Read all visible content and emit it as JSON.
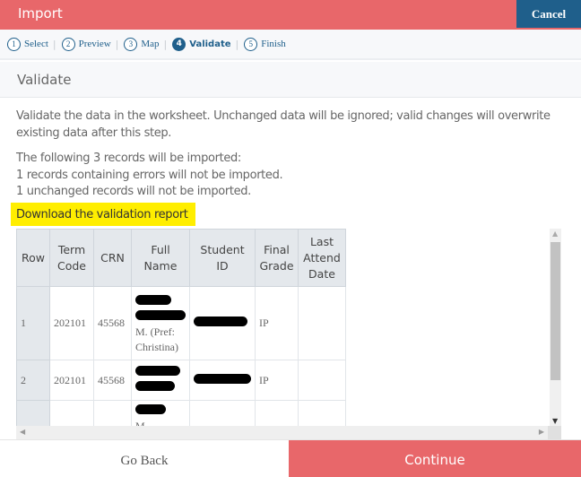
{
  "header": {
    "title": "Import",
    "cancel_label": "Cancel"
  },
  "steps": [
    {
      "num": "1",
      "label": "Select",
      "active": false
    },
    {
      "num": "2",
      "label": "Preview",
      "active": false
    },
    {
      "num": "3",
      "label": "Map",
      "active": false
    },
    {
      "num": "4",
      "label": "Validate",
      "active": true
    },
    {
      "num": "5",
      "label": "Finish",
      "active": false
    }
  ],
  "step_separator": "|",
  "section": {
    "title": "Validate"
  },
  "content": {
    "intro": "Validate the data in the worksheet. Unchanged data will be ignored; valid changes will overwrite existing data after this step.",
    "summary_lines": [
      "The following 3 records will be imported:",
      "1 records containing errors will not be imported.",
      "1 unchanged records will not be imported."
    ],
    "download_link": "Download the validation report"
  },
  "table": {
    "headers": [
      "Row",
      "Term Code",
      "CRN",
      "Full Name",
      "Student ID",
      "Final Grade",
      "Last Attend Date"
    ],
    "rows": [
      {
        "row": "1",
        "term_code": "202101",
        "crn": "45568",
        "full_name_visible": "M. (Pref: Christina)",
        "student_id": "[redacted]",
        "final_grade": "IP",
        "last_attend_date": ""
      },
      {
        "row": "2",
        "term_code": "202101",
        "crn": "45568",
        "full_name_visible": "",
        "student_id": "[redacted]",
        "final_grade": "IP",
        "last_attend_date": ""
      },
      {
        "row": "",
        "term_code": "",
        "crn": "",
        "full_name_visible": "M...",
        "student_id": "",
        "final_grade": "",
        "last_attend_date": ""
      }
    ]
  },
  "scrollbars": {
    "up": "▲",
    "down": "▼",
    "left": "◀",
    "right": "▶"
  },
  "footer": {
    "go_back_label": "Go Back",
    "continue_label": "Continue"
  },
  "colors": {
    "brand": "#e8676a",
    "accent": "#1f5f8b",
    "highlight": "#ffee00"
  }
}
